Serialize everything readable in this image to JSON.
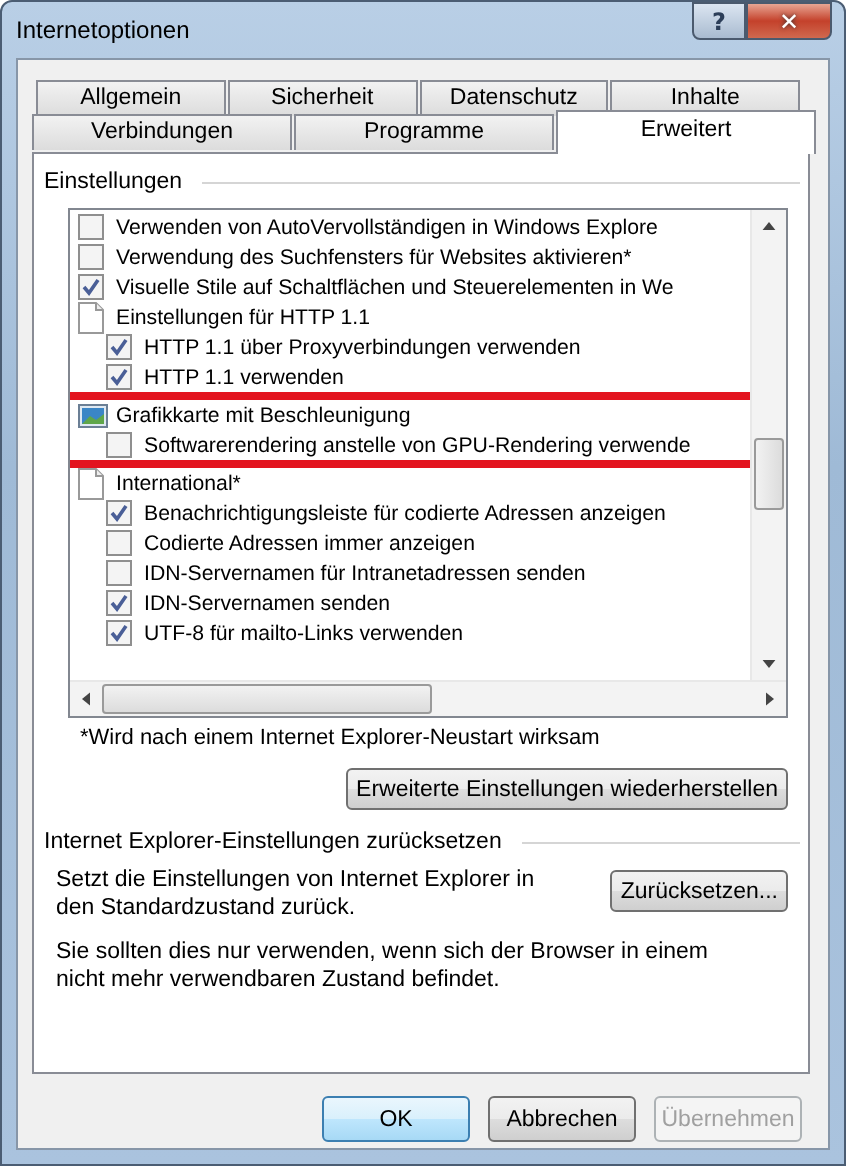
{
  "window": {
    "title": "Internetoptionen",
    "help_button": "?",
    "close_button": "✕"
  },
  "tabs": [
    [
      {
        "label": "Allgemein",
        "selected": false
      },
      {
        "label": "Sicherheit",
        "selected": false
      },
      {
        "label": "Datenschutz",
        "selected": false
      },
      {
        "label": "Inhalte",
        "selected": false
      }
    ],
    [
      {
        "label": "Verbindungen",
        "selected": false
      },
      {
        "label": "Programme",
        "selected": false
      },
      {
        "label": "Erweitert",
        "selected": true
      }
    ]
  ],
  "settings": {
    "heading": "Einstellungen",
    "items": [
      {
        "kind": "checkbox",
        "label": "Verwenden von AutoVervollständigen in Windows Explore",
        "checked": false
      },
      {
        "kind": "checkbox",
        "label": "Verwendung des Suchfensters für Websites aktivieren*",
        "checked": false
      },
      {
        "kind": "checkbox",
        "label": "Visuelle Stile auf Schaltflächen und Steuerelementen in We",
        "checked": true
      },
      {
        "kind": "category",
        "label": "Einstellungen für HTTP 1.1",
        "children": [
          {
            "kind": "checkbox",
            "label": "HTTP 1.1 über Proxyverbindungen verwenden",
            "checked": true
          },
          {
            "kind": "checkbox",
            "label": "HTTP 1.1 verwenden",
            "checked": true
          }
        ]
      },
      {
        "kind": "graphics",
        "label": "Grafikkarte mit Beschleunigung",
        "highlighted": true,
        "children": [
          {
            "kind": "checkbox",
            "label": "Softwarerendering anstelle von GPU-Rendering verwende",
            "checked": false
          }
        ]
      },
      {
        "kind": "category",
        "label": "International*",
        "children": [
          {
            "kind": "checkbox",
            "label": "Benachrichtigungsleiste für codierte Adressen anzeigen",
            "checked": true
          },
          {
            "kind": "checkbox",
            "label": "Codierte Adressen immer anzeigen",
            "checked": false
          },
          {
            "kind": "checkbox",
            "label": "IDN-Servernamen für Intranetadressen senden",
            "checked": false
          },
          {
            "kind": "checkbox",
            "label": "IDN-Servernamen senden",
            "checked": true
          },
          {
            "kind": "checkbox",
            "label": "UTF-8 für mailto-Links verwenden",
            "checked": true
          }
        ]
      }
    ],
    "note": "*Wird nach einem Internet Explorer-Neustart wirksam",
    "restore_button": "Erweiterte Einstellungen wiederherstellen"
  },
  "reset": {
    "heading": "Internet Explorer-Einstellungen zurücksetzen",
    "description": "Setzt die Einstellungen von Internet Explorer in den Standardzustand zurück.",
    "button": "Zurücksetzen...",
    "warning": "Sie sollten dies nur verwenden, wenn sich der Browser in einem nicht mehr verwendbaren Zustand befindet."
  },
  "buttons": [
    {
      "label": "OK",
      "kind": "default",
      "disabled": false
    },
    {
      "label": "Abbrechen",
      "kind": "normal",
      "disabled": false
    },
    {
      "label": "Übernehmen",
      "kind": "normal",
      "disabled": true
    }
  ]
}
